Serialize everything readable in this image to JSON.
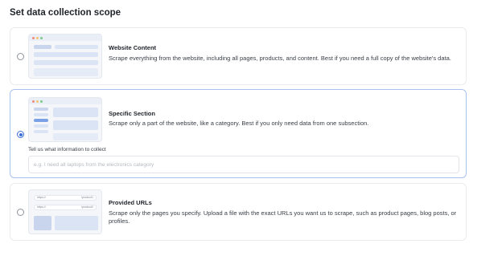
{
  "heading": "Set data collection scope",
  "options": [
    {
      "title": "Website Content",
      "description": "Scrape everything from the website, including all pages, products, and content. Best if you need a full copy of the website's data.",
      "selected": false
    },
    {
      "title": "Specific Section",
      "description": "Scrape only a part of the website, like a category. Best if you only need data from one subsection.",
      "selected": true,
      "field_label": "Tell us what information to collect",
      "field_placeholder": "e.g. I need all laptops from the electronics category",
      "field_value": ""
    },
    {
      "title": "Provided URLs",
      "description": "Scrape only the pages you specify. Upload a file with the exact URLs you want us to scrape, such as product pages, blog posts, or profiles.",
      "selected": false
    }
  ],
  "url_thumb": {
    "rows": [
      {
        "left": "https://",
        "right": "/product1"
      },
      {
        "left": "https://",
        "right": "/product2"
      }
    ]
  },
  "colors": {
    "accent": "#3b6fd6",
    "selected_border": "#a9c1ee",
    "card_border": "#e9ebee",
    "thumb_fill": "#dbe4f5"
  }
}
